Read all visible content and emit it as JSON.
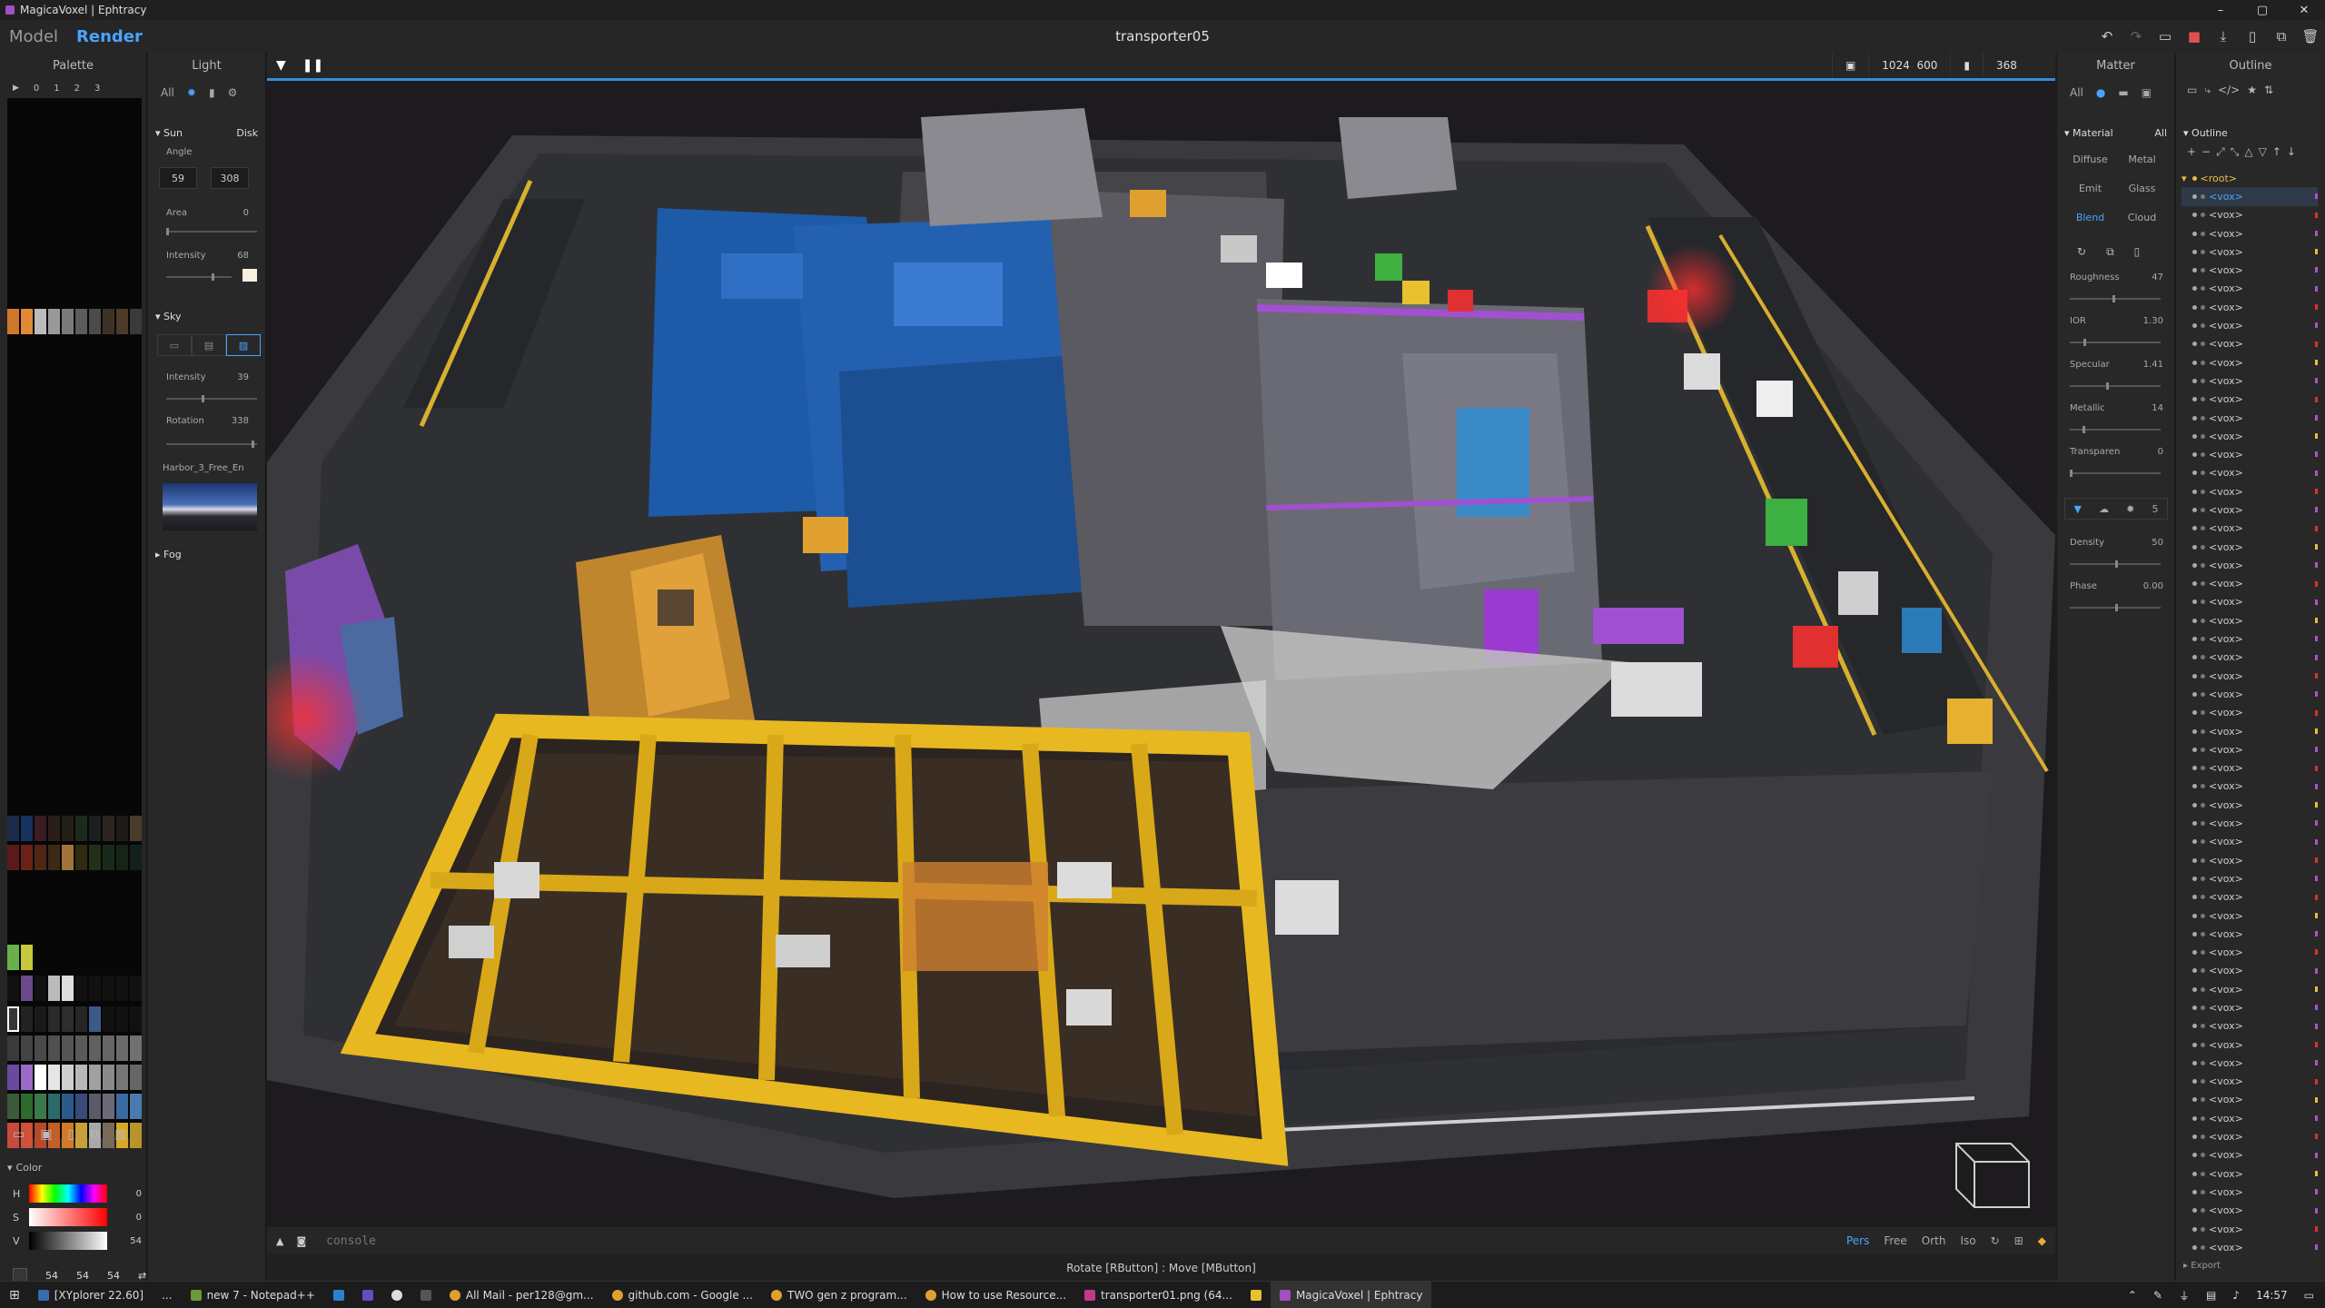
{
  "window": {
    "title": "MagicaVoxel | Ephtracy",
    "controls": [
      "–",
      "▢",
      "✕"
    ]
  },
  "menubar": {
    "model": "Model",
    "render": "Render",
    "doc_title": "transporter05"
  },
  "palette": {
    "title": "Palette",
    "tabs": [
      "0",
      "1",
      "2",
      "3"
    ]
  },
  "color": {
    "title": "Color",
    "h": "0",
    "s": "0",
    "v": "54",
    "r": "54",
    "g": "54",
    "b": "54"
  },
  "light": {
    "title": "Light",
    "tab_all": "All",
    "sun": "Sun",
    "disk": "Disk",
    "angle": "Angle",
    "angle_a": "59",
    "angle_b": "308",
    "area": "Area",
    "area_val": "0",
    "intensity": "Intensity",
    "intensity_val": "68",
    "sky": "Sky",
    "sky_intensity": "Intensity",
    "sky_intensity_val": "39",
    "rotation": "Rotation",
    "rotation_val": "338",
    "hdri": "Harbor_3_Free_En",
    "fog": "Fog"
  },
  "viewport": {
    "width": "1024",
    "height": "600",
    "samples": "368",
    "progress": 1.0,
    "console": "console",
    "status": "Rotate [RButton] : Move [MButton]",
    "camera": [
      "Pers",
      "Free",
      "Orth",
      "Iso"
    ],
    "camera_active": "Pers"
  },
  "matter": {
    "title": "Matter",
    "tab_all": "All",
    "material": "Material",
    "mat_all": "All",
    "types": [
      "Diffuse",
      "Metal",
      "Emit",
      "Glass",
      "Blend",
      "Cloud"
    ],
    "type_active": "Blend",
    "roughness": "Roughness",
    "roughness_val": "47",
    "ior": "IOR",
    "ior_val": "1.30",
    "specular": "Specular",
    "specular_val": "1.41",
    "metallic": "Metallic",
    "metallic_val": "14",
    "transparent": "Transparen",
    "transparent_val": "0",
    "density": "Density",
    "density_val": "50",
    "phase": "Phase",
    "phase_val": "0.00",
    "count": "5"
  },
  "outline": {
    "title": "Outline",
    "section": "Outline",
    "root": "<root>",
    "item": "<vox>",
    "export": "Export"
  },
  "taskbar": {
    "items": [
      "[XYplorer 22.60]",
      "...",
      "new 7 - Notepad++",
      "All Mail - per128@gm...",
      "github.com - Google ...",
      "TWO gen z program...",
      "How to use Resource...",
      "transporter01.png (64...",
      "MagicaVoxel | Ephtracy"
    ],
    "time": "14:57"
  },
  "colors": {
    "accent": "#4aa3ff",
    "panel": "#282828",
    "bg": "#1e1e1e",
    "root": "#e8c040"
  }
}
